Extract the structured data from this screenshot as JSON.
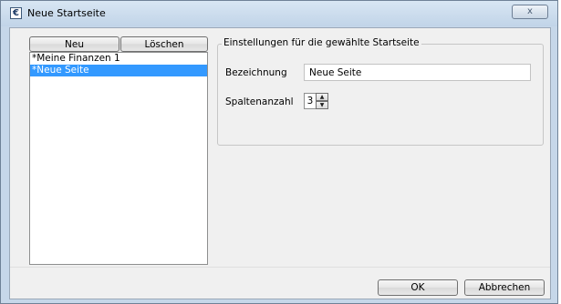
{
  "window": {
    "title": "Neue Startseite",
    "app_icon_glyph": "€",
    "close_glyph": "x",
    "accent_color": "#3399ff"
  },
  "toolbar": {
    "new_label": "Neu",
    "delete_label": "Löschen"
  },
  "list": {
    "items": [
      {
        "label": "*Meine Finanzen 1",
        "selected": false
      },
      {
        "label": "*Neue Seite",
        "selected": true
      }
    ]
  },
  "settings": {
    "group_title": "Einstellungen für die gewählte Startseite",
    "name_label": "Bezeichnung",
    "name_value": "Neue Seite",
    "columns_label": "Spaltenanzahl",
    "columns_value": "3"
  },
  "footer": {
    "ok_label": "OK",
    "cancel_label": "Abbrechen"
  }
}
